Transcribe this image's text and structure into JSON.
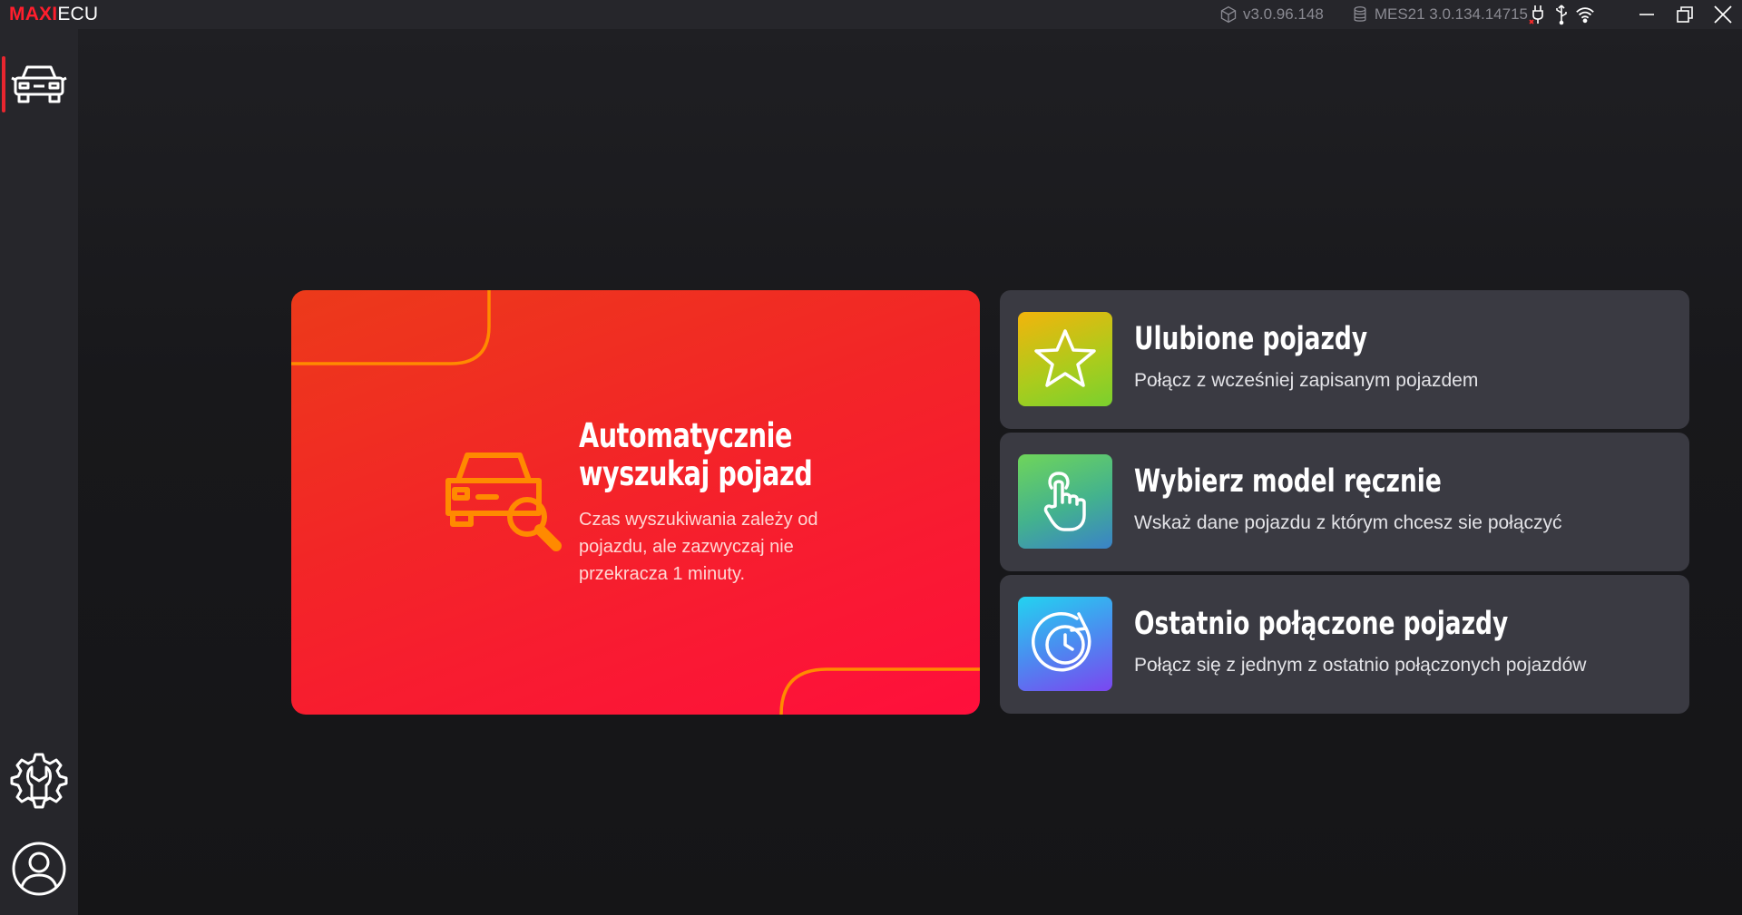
{
  "app": {
    "logo_part1": "MAXI",
    "logo_part2": "ECU",
    "version": "v3.0.96.148",
    "database": "MES21 3.0.134.14715"
  },
  "icons": {
    "version": "cube-icon",
    "database": "database-icon",
    "obd": "obd-plug-icon",
    "usb": "usb-icon",
    "wifi": "wifi-icon",
    "minimize": "minimize-icon",
    "restore": "restore-icon",
    "close": "close-icon",
    "vehicle": "car-icon",
    "service": "gear-wrench-icon",
    "user": "user-icon"
  },
  "colors": {
    "brand_red": "#ff1e2d",
    "accent_orange": "#ff8a00",
    "card_bg": "#3a3a42"
  },
  "auto_search": {
    "title": "Automatycznie wyszukaj pojazd",
    "description": "Czas wyszukiwania zależy od pojazdu, ale zazwyczaj nie przekracza 1 minuty."
  },
  "options": [
    {
      "title": "Ulubione pojazdy",
      "description": "Połącz z wcześniej zapisanym pojazdem",
      "icon": "star-icon"
    },
    {
      "title": "Wybierz model ręcznie",
      "description": "Wskaż dane pojazdu z którym chcesz sie połączyć",
      "icon": "hand-pointer-icon"
    },
    {
      "title": "Ostatnio połączone pojazdy",
      "description": "Połącz się z jednym z ostatnio połączonych pojazdów",
      "icon": "history-clock-icon"
    }
  ]
}
